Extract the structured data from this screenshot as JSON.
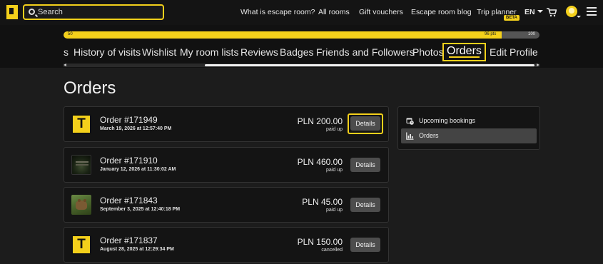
{
  "nav": {
    "search_placeholder": "Search",
    "links": [
      "What is escape room?",
      "All rooms",
      "Gift vouchers",
      "Escape room blog",
      "Trip planner"
    ],
    "beta_badge": "BETA",
    "language": "EN"
  },
  "progress": {
    "start_label": "50",
    "current_label": "96 pts",
    "end_label": "100",
    "start_value": 50,
    "current_value": 96,
    "end_value": 100,
    "accent_color": "#f4d01b"
  },
  "tabs": [
    {
      "label": "s"
    },
    {
      "label": "History of visits"
    },
    {
      "label": "Wishlist"
    },
    {
      "label": "My room lists"
    },
    {
      "label": "Reviews"
    },
    {
      "label": "Badges"
    },
    {
      "label": "Friends and Followers"
    },
    {
      "label": "Photos"
    },
    {
      "label": "Orders",
      "active": true
    },
    {
      "label": "Edit Profile"
    }
  ],
  "main": {
    "title": "Orders",
    "details_label": "Details",
    "orders": [
      {
        "number": "Order #171949",
        "date": "March 19, 2026 at 12:57:40 PM",
        "price": "PLN 200.00",
        "status": "paid up",
        "thumb": "brand-logo"
      },
      {
        "number": "Order #171910",
        "date": "January 12, 2026 at 11:30:02 AM",
        "price": "PLN 460.00",
        "status": "paid up",
        "thumb": "dark-room-poster"
      },
      {
        "number": "Order #171843",
        "date": "September 3, 2025 at 12:40:18 PM",
        "price": "PLN 45.00",
        "status": "paid up",
        "thumb": "bear-photo"
      },
      {
        "number": "Order #171837",
        "date": "August 28, 2025 at 12:29:34 PM",
        "price": "PLN 150.00",
        "status": "cancelled",
        "thumb": "brand-logo"
      }
    ]
  },
  "side": {
    "items": [
      {
        "label": "Upcoming bookings",
        "icon": "calendar-clock-icon"
      },
      {
        "label": "Orders",
        "icon": "orders-chart-icon",
        "active": true
      }
    ]
  }
}
